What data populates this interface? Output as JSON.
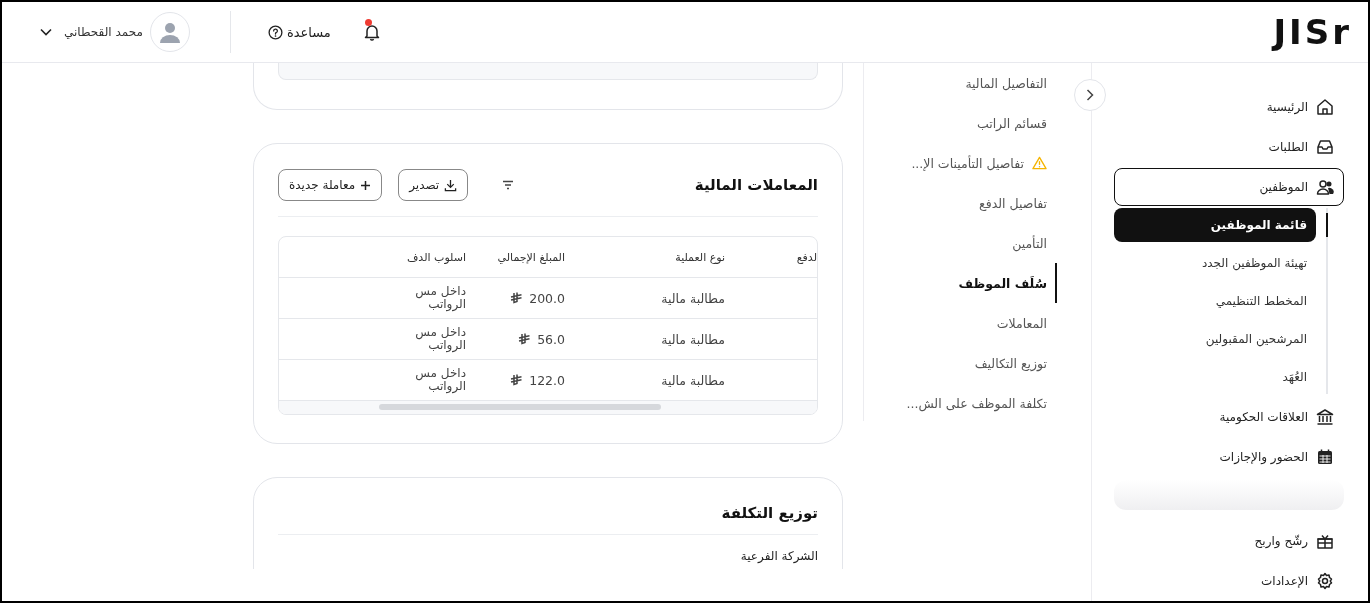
{
  "logo": "JISr",
  "header": {
    "notifications": {
      "unread": true
    },
    "help": "مساعدة",
    "user": {
      "name": "محمد القحطاني"
    }
  },
  "sidebar": {
    "items_top": [
      {
        "label": "الرئيسية",
        "expanded": false
      },
      {
        "label": "الطلبات",
        "expanded": false
      },
      {
        "label": "الموظفين",
        "expanded": true,
        "children": [
          {
            "label": "قائمة الموظفين",
            "selected": true
          },
          {
            "label": "تهيئة الموظفين الجدد",
            "selected": false
          },
          {
            "label": "المخطط التنظيمي",
            "selected": false
          },
          {
            "label": "المرشحين المقبولين",
            "selected": false
          },
          {
            "label": "العُهَد",
            "selected": false
          }
        ]
      },
      {
        "label": "العلاقات الحكومية",
        "expanded": false
      },
      {
        "label": "الحضور والإجازات",
        "expanded": false
      }
    ],
    "items_bottom": [
      {
        "label": "رشّح واربح",
        "expanded": false
      },
      {
        "label": "الإعدادات",
        "expanded": false
      }
    ]
  },
  "section_nav": [
    {
      "label": "التفاصيل المالية",
      "selected": false,
      "warning": false
    },
    {
      "label": "قسائم الراتب",
      "selected": false,
      "warning": false
    },
    {
      "label": "تفاصيل التأمينات الإ...",
      "selected": false,
      "warning": true
    },
    {
      "label": "تفاصيل الدفع",
      "selected": false,
      "warning": false
    },
    {
      "label": "التأمين",
      "selected": false,
      "warning": false
    },
    {
      "label": "سُلَف الموظف",
      "selected": true,
      "warning": false
    },
    {
      "label": "المعاملات",
      "selected": false,
      "warning": false
    },
    {
      "label": "توزيع التكاليف",
      "selected": false,
      "warning": false
    },
    {
      "label": "تكلفة الموظف على الش...",
      "selected": false,
      "warning": false
    }
  ],
  "transactions": {
    "title": "المعاملات المالية",
    "export_button": "تصدير",
    "new_button": "معاملة جديدة",
    "columns": [
      "لدفع",
      "نوع العملية",
      "المبلغ الإجمالي",
      "اسلوب الدف"
    ],
    "rows": [
      {
        "type": "مطالبة مالية",
        "amount": "200.0",
        "method": "داخل مس الرواتب"
      },
      {
        "type": "مطالبة مالية",
        "amount": "56.0",
        "method": "داخل مس الرواتب"
      },
      {
        "type": "مطالبة مالية",
        "amount": "122.0",
        "method": "داخل مس الرواتب"
      }
    ]
  },
  "cost_distribution": {
    "title": "توزيع التكلفة",
    "first_field": "الشركة الفرعية"
  }
}
